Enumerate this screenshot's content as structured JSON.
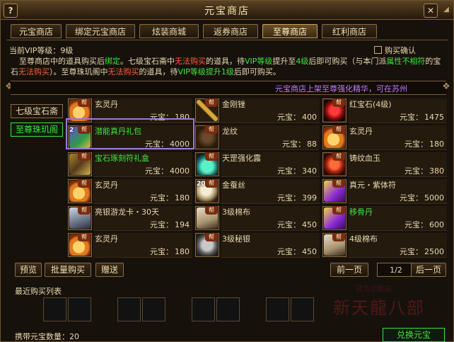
{
  "window": {
    "title": "元宝商店",
    "help_label": "?",
    "close_label": "✕",
    "min_label": "◢"
  },
  "tabs": [
    {
      "label": "元宝商店"
    },
    {
      "label": "绑定元宝商店"
    },
    {
      "label": "炫装商城"
    },
    {
      "label": "返券商店"
    },
    {
      "label": "至尊商店"
    },
    {
      "label": "红利商店"
    }
  ],
  "vip": {
    "label": "当前VIP等级：9级"
  },
  "purchase_confirm": {
    "label": "购买确认"
  },
  "notice": {
    "p1": "至尊商店中的道具购买后",
    "p2": "绑定",
    "p3": "。七级宝石斋中",
    "p4": "无法购买",
    "p5": "的道具，待",
    "p6": "VIP等级",
    "p7": "提升至",
    "p8": "4级",
    "p9": "后即可购买（与",
    "p10": "本门派",
    "p11": "属性不相符",
    "p12": "的宝石",
    "p13": "无法购买",
    "p14": "）。至尊珠玑阁中",
    "p15": "无法购买",
    "p16": "的道具，待",
    "p17": "VIP等级",
    "p18": "提升1级",
    "p19": "后即可购买。"
  },
  "marquee": "元宝商店上架至尊强化精华，可在苏州",
  "side_tabs": [
    {
      "label": "七级宝石斋"
    },
    {
      "label": "至尊珠玑阁"
    }
  ],
  "items": [
    {
      "name": "玄灵丹",
      "price_label": "元宝：",
      "price": "180",
      "icon": "pill-icon",
      "green": false
    },
    {
      "name": "金刚锉",
      "price_label": "元宝：",
      "price": "400",
      "icon": "file-icon",
      "green": false
    },
    {
      "name": "红宝石(4级)",
      "price_label": "元宝：",
      "price": "1475",
      "icon": "ruby-icon",
      "green": false
    },
    {
      "name": "潜能真丹礼包",
      "price_label": "元宝：",
      "price": "4000",
      "icon": "giftbox-icon",
      "green": true,
      "count": "2"
    },
    {
      "name": "龙纹",
      "price_label": "元宝：",
      "price": "88",
      "icon": "dragon-pattern-icon",
      "green": false
    },
    {
      "name": "玄灵丹",
      "price_label": "元宝：",
      "price": "180",
      "icon": "pill-icon",
      "green": false
    },
    {
      "name": "宝石琢刻符礼盒",
      "price_label": "元宝：",
      "price": "4000",
      "icon": "gem-giftbox-icon",
      "green": true
    },
    {
      "name": "天罡强化露",
      "price_label": "元宝：",
      "price": "340",
      "icon": "potion-icon",
      "green": false
    },
    {
      "name": "铸纹血玉",
      "price_label": "元宝：",
      "price": "380",
      "icon": "blood-jade-icon",
      "green": false
    },
    {
      "name": "玄灵丹",
      "price_label": "元宝：",
      "price": "180",
      "icon": "pill-icon",
      "green": false
    },
    {
      "name": "金蚕丝",
      "price_label": "元宝：",
      "price": "399",
      "icon": "silk-icon",
      "green": false,
      "count": "20"
    },
    {
      "name": "真元・紫体符",
      "price_label": "元宝：",
      "price": "5000",
      "icon": "talisman-icon",
      "green": false
    },
    {
      "name": "亮银游龙卡・30天",
      "price_label": "元宝：",
      "price": "194",
      "icon": "card-icon",
      "green": false
    },
    {
      "name": "3级棉布",
      "price_label": "元宝：",
      "price": "450",
      "icon": "cloth-icon",
      "green": false
    },
    {
      "name": "移骨丹",
      "price_label": "元宝：",
      "price": "600",
      "icon": "bone-pill-icon",
      "green": true
    },
    {
      "name": "玄灵丹",
      "price_label": "元宝：",
      "price": "180",
      "icon": "pill-icon",
      "green": false
    },
    {
      "name": "3级秘银",
      "price_label": "元宝：",
      "price": "450",
      "icon": "mithril-icon",
      "green": false
    },
    {
      "name": "4级棉布",
      "price_label": "元宝：",
      "price": "2500",
      "icon": "cloth-icon",
      "green": false
    }
  ],
  "item_tag": "帮",
  "bottom": {
    "preview": "预览",
    "batch": "批量购买",
    "gift": "赠送",
    "prev": "前一页",
    "page": "1/2",
    "next": "后一页"
  },
  "recent_label": "最近购买列表",
  "watermark": {
    "small": "官方记者站",
    "big": "新天龍八部"
  },
  "footer": {
    "label": "携带元宝数量：20"
  },
  "exchange_label": "兑换元宝",
  "colors": {
    "accent_green": "#3ee53e",
    "warning_red": "#ff5a3a",
    "marquee_purple": "#c678ff",
    "gold_border": "#8b6c3e"
  }
}
